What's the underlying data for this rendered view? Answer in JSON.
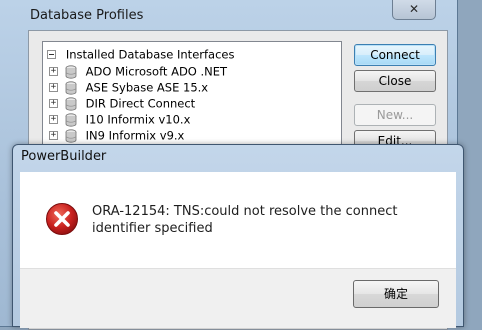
{
  "profiles_window": {
    "title": "Database Profiles",
    "close_glyph": "✕",
    "tree": {
      "root_label": "Installed Database Interfaces",
      "items": [
        {
          "label": "ADO Microsoft ADO .NET",
          "icon": "database-icon"
        },
        {
          "label": "ASE Sybase ASE 15.x",
          "icon": "database-icon"
        },
        {
          "label": "DIR Direct Connect",
          "icon": "database-icon"
        },
        {
          "label": "I10 Informix v10.x",
          "icon": "database-icon"
        },
        {
          "label": "IN9 Informix v9.x",
          "icon": "database-icon"
        }
      ]
    },
    "buttons": {
      "connect": "Connect",
      "close": "Close",
      "new": "New...",
      "edit": "Edit..."
    }
  },
  "error_dialog": {
    "title": "PowerBuilder",
    "message": "ORA-12154: TNS:could not resolve the connect identifier specified",
    "icon": "error-icon",
    "ok_label": "确定"
  },
  "colors": {
    "error_red": "#c8201e",
    "default_button_border": "#3c7fb1"
  }
}
